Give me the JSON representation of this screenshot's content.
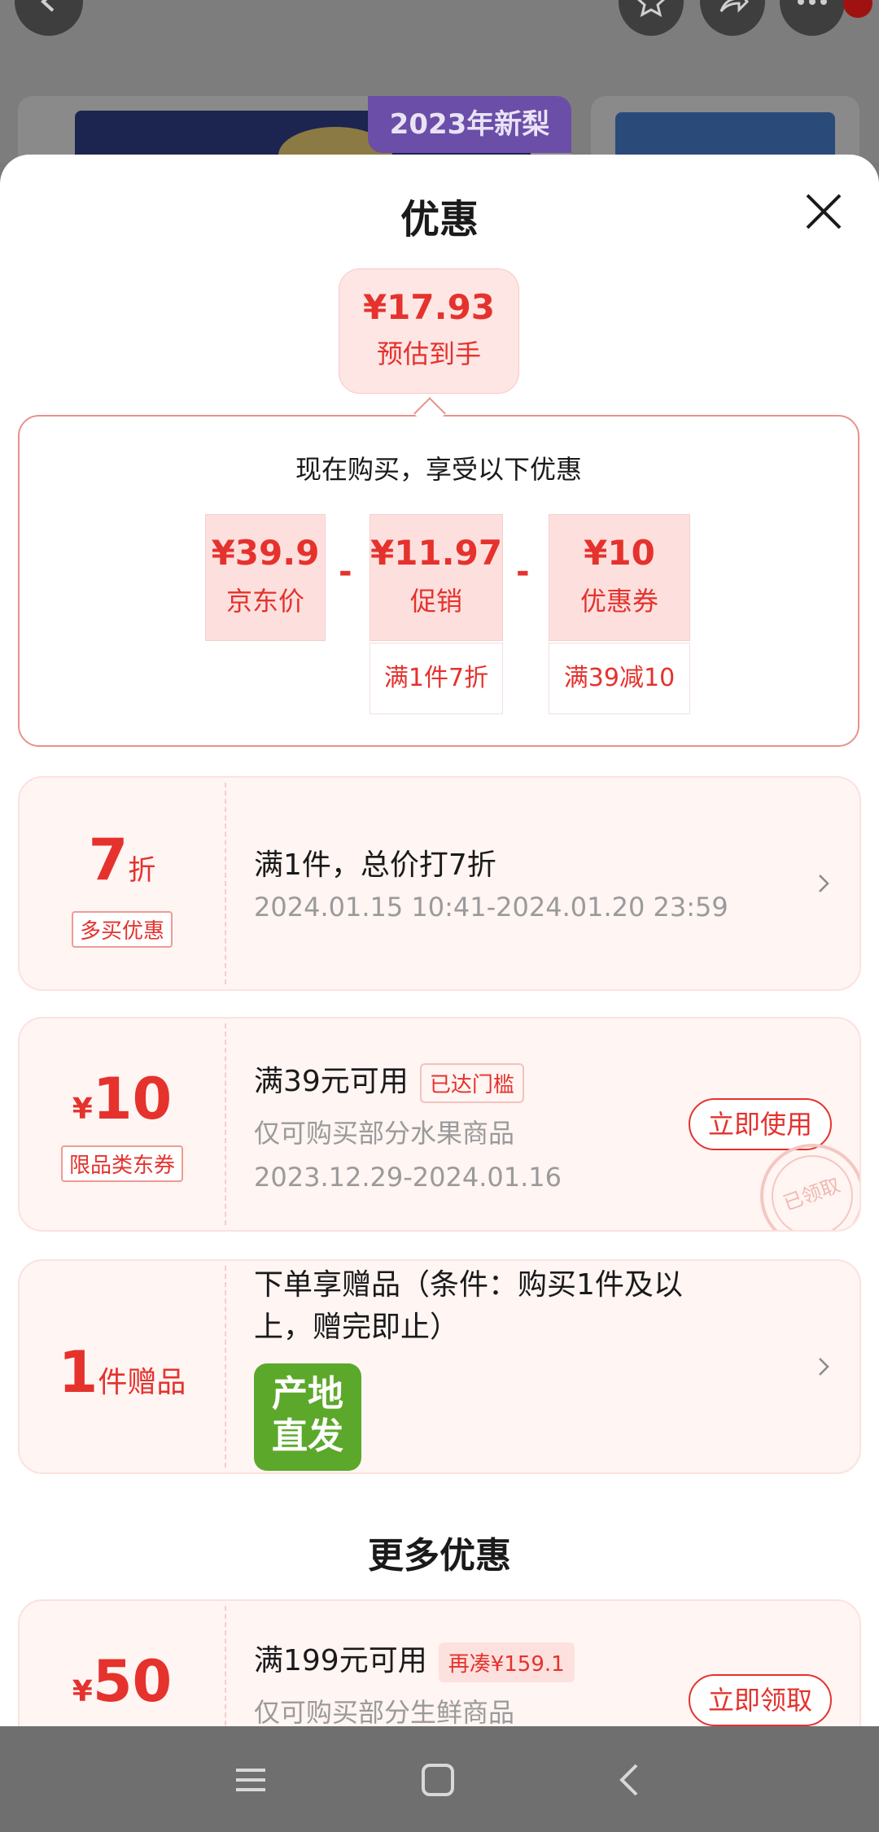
{
  "background": {
    "product_tag": "2023年新梨"
  },
  "sheet": {
    "title": "优惠",
    "estimate": {
      "price": "¥17.93",
      "label": "预估到手"
    },
    "breakdown": {
      "title": "现在购买，享受以下优惠",
      "items": [
        {
          "value": "¥39.9",
          "name": "京东价",
          "condition": ""
        },
        {
          "value": "¥11.97",
          "name": "促销",
          "condition": "满1件7折"
        },
        {
          "value": "¥10",
          "name": "优惠券",
          "condition": "满39减10"
        }
      ],
      "operator": "-"
    },
    "offers": [
      {
        "big": "7",
        "unit": "折",
        "tag": "多买优惠",
        "title": "满1件，总价打7折",
        "period": "2024.01.15 10:41-2024.01.20 23:59"
      },
      {
        "currency": "¥",
        "big": "10",
        "tag": "限品类东券",
        "title": "满39元可用",
        "badge": "已达门槛",
        "desc": "仅可购买部分水果商品",
        "period": "2023.12.29-2024.01.16",
        "action": "立即使用",
        "stamp": "已领取"
      },
      {
        "big": "1",
        "unit": "件赠品",
        "title_line1": "下单享赠品（条件：购买1件及以",
        "title_line2": "上，赠完即止）",
        "gift_line1": "产地",
        "gift_line2": "直发"
      }
    ],
    "more": {
      "title": "更多优惠",
      "coupon": {
        "currency": "¥",
        "big": "50",
        "title": "满199元可用",
        "badge": "再凑¥159.1",
        "desc": "仅可购买部分生鲜商品",
        "action": "立即领取"
      }
    }
  },
  "icons": {
    "close": "close-icon",
    "chevron": "chevron-right-icon",
    "nav": [
      "menu-icon",
      "home-square-icon",
      "back-icon"
    ]
  },
  "colors": {
    "accent": "#e5322d",
    "card_bg": "#fff5f3",
    "gift_green": "#5ca82b"
  }
}
